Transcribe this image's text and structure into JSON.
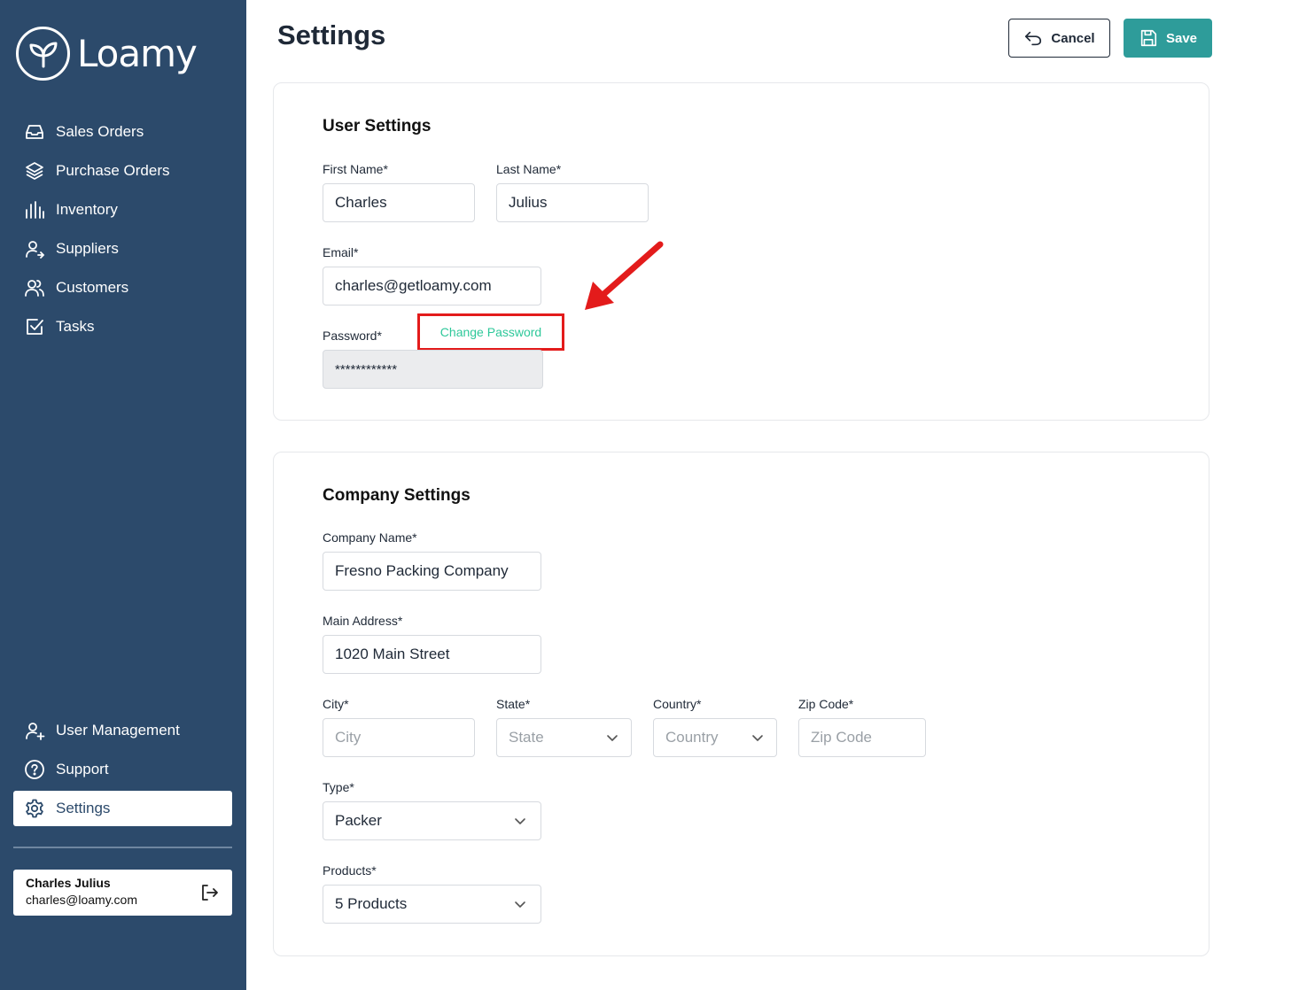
{
  "app": {
    "name": "Loamy"
  },
  "sidebar": {
    "top_items": [
      {
        "label": "Sales Orders",
        "icon": "inbox-icon"
      },
      {
        "label": "Purchase Orders",
        "icon": "layers-icon"
      },
      {
        "label": "Inventory",
        "icon": "bar-chart-icon"
      },
      {
        "label": "Suppliers",
        "icon": "user-arrow-icon"
      },
      {
        "label": "Customers",
        "icon": "users-icon"
      },
      {
        "label": "Tasks",
        "icon": "checkbox-icon"
      }
    ],
    "bottom_items": [
      {
        "label": "User Management",
        "icon": "user-plus-icon"
      },
      {
        "label": "Support",
        "icon": "help-circle-icon"
      },
      {
        "label": "Settings",
        "icon": "gear-icon",
        "active": true
      }
    ],
    "user": {
      "name": "Charles Julius",
      "email": "charles@loamy.com"
    }
  },
  "header": {
    "title": "Settings",
    "cancel_label": "Cancel",
    "save_label": "Save"
  },
  "user_settings": {
    "title": "User Settings",
    "first_name": {
      "label": "First Name*",
      "value": "Charles"
    },
    "last_name": {
      "label": "Last Name*",
      "value": "Julius"
    },
    "email": {
      "label": "Email*",
      "value": "charles@getloamy.com"
    },
    "password": {
      "label": "Password*",
      "value": "************",
      "change_label": "Change Password"
    }
  },
  "company_settings": {
    "title": "Company Settings",
    "company_name": {
      "label": "Company Name*",
      "value": "Fresno Packing Company"
    },
    "main_address": {
      "label": "Main Address*",
      "value": "1020 Main Street"
    },
    "city": {
      "label": "City*",
      "placeholder": "City"
    },
    "state": {
      "label": "State*",
      "placeholder": "State"
    },
    "country": {
      "label": "Country*",
      "placeholder": "Country"
    },
    "zip": {
      "label": "Zip Code*",
      "placeholder": "Zip Code"
    },
    "type": {
      "label": "Type*",
      "value": "Packer"
    },
    "products": {
      "label": "Products*",
      "value": "5 Products"
    }
  },
  "colors": {
    "sidebar_bg": "#2c4a6b",
    "accent": "#2e9c9a",
    "link": "#2ec89a",
    "highlight": "#e31b1b"
  }
}
